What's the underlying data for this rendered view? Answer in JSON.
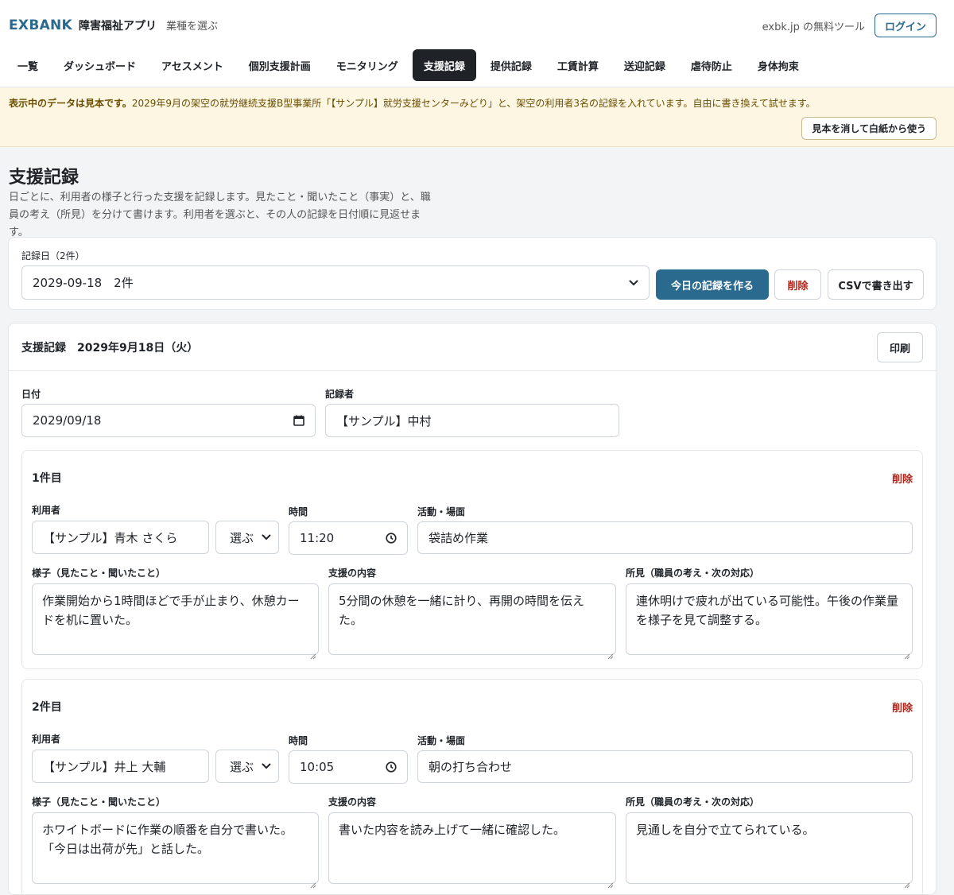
{
  "header": {
    "brand": "EXBANK",
    "app_name": "障害福祉アプリ",
    "select_industry": "業種を選ぶ",
    "tool_text": "exbk.jp の無料ツール",
    "login": "ログイン"
  },
  "nav": [
    "一覧",
    "ダッシュボード",
    "アセスメント",
    "個別支援計画",
    "モニタリング",
    "支援記録",
    "提供記録",
    "工賃計算",
    "送迎記録",
    "虐待防止",
    "身体拘束"
  ],
  "nav_active": "支援記録",
  "banner": {
    "strong": "表示中のデータは見本です。",
    "text": "2029年9月の架空の就労継続支援B型事業所「【サンプル】就労支援センターみどり」と、架空の利用者3名の記録を入れています。自由に書き換えて試せます。",
    "button": "見本を消して白紙から使う"
  },
  "page": {
    "title": "支援記録",
    "desc": "日ごとに、利用者の様子と行った支援を記録します。見たこと・聞いたこと（事実）と、職員の考え（所見）を分けて書けます。利用者を選ぶと、その人の記録を日付順に見返せます。"
  },
  "record_select": {
    "label": "記録日（2件）",
    "value": "2029-09-18　2件",
    "create": "今日の記録を作る",
    "delete": "削除",
    "csv": "CSVで書き出す"
  },
  "record": {
    "title": "支援記録　2029年9月18日（火）",
    "print": "印刷",
    "date_label": "日付",
    "date_value": "2029/09/18",
    "recorder_label": "記録者",
    "recorder_value": "【サンプル】中村",
    "labels": {
      "user": "利用者",
      "time": "時間",
      "activity": "活動・場面",
      "state": "様子（見たこと・聞いたこと）",
      "support": "支援の内容",
      "opinion": "所見（職員の考え・次の対応）",
      "choose": "選ぶ",
      "delete": "削除"
    },
    "entries": [
      {
        "heading": "1件目",
        "user": "【サンプル】青木 さくら",
        "time": "11:20",
        "activity": "袋詰め作業",
        "state": "作業開始から1時間ほどで手が止まり、休憩カードを机に置いた。",
        "support": "5分間の休憩を一緒に計り、再開の時間を伝えた。",
        "opinion": "連休明けで疲れが出ている可能性。午後の作業量を様子を見て調整する。"
      },
      {
        "heading": "2件目",
        "user": "【サンプル】井上 大輔",
        "time": "10:05",
        "activity": "朝の打ち合わせ",
        "state": "ホワイトボードに作業の順番を自分で書いた。「今日は出荷が先」と話した。",
        "support": "書いた内容を読み上げて一緒に確認した。",
        "opinion": "見通しを自分で立てられている。"
      }
    ]
  }
}
